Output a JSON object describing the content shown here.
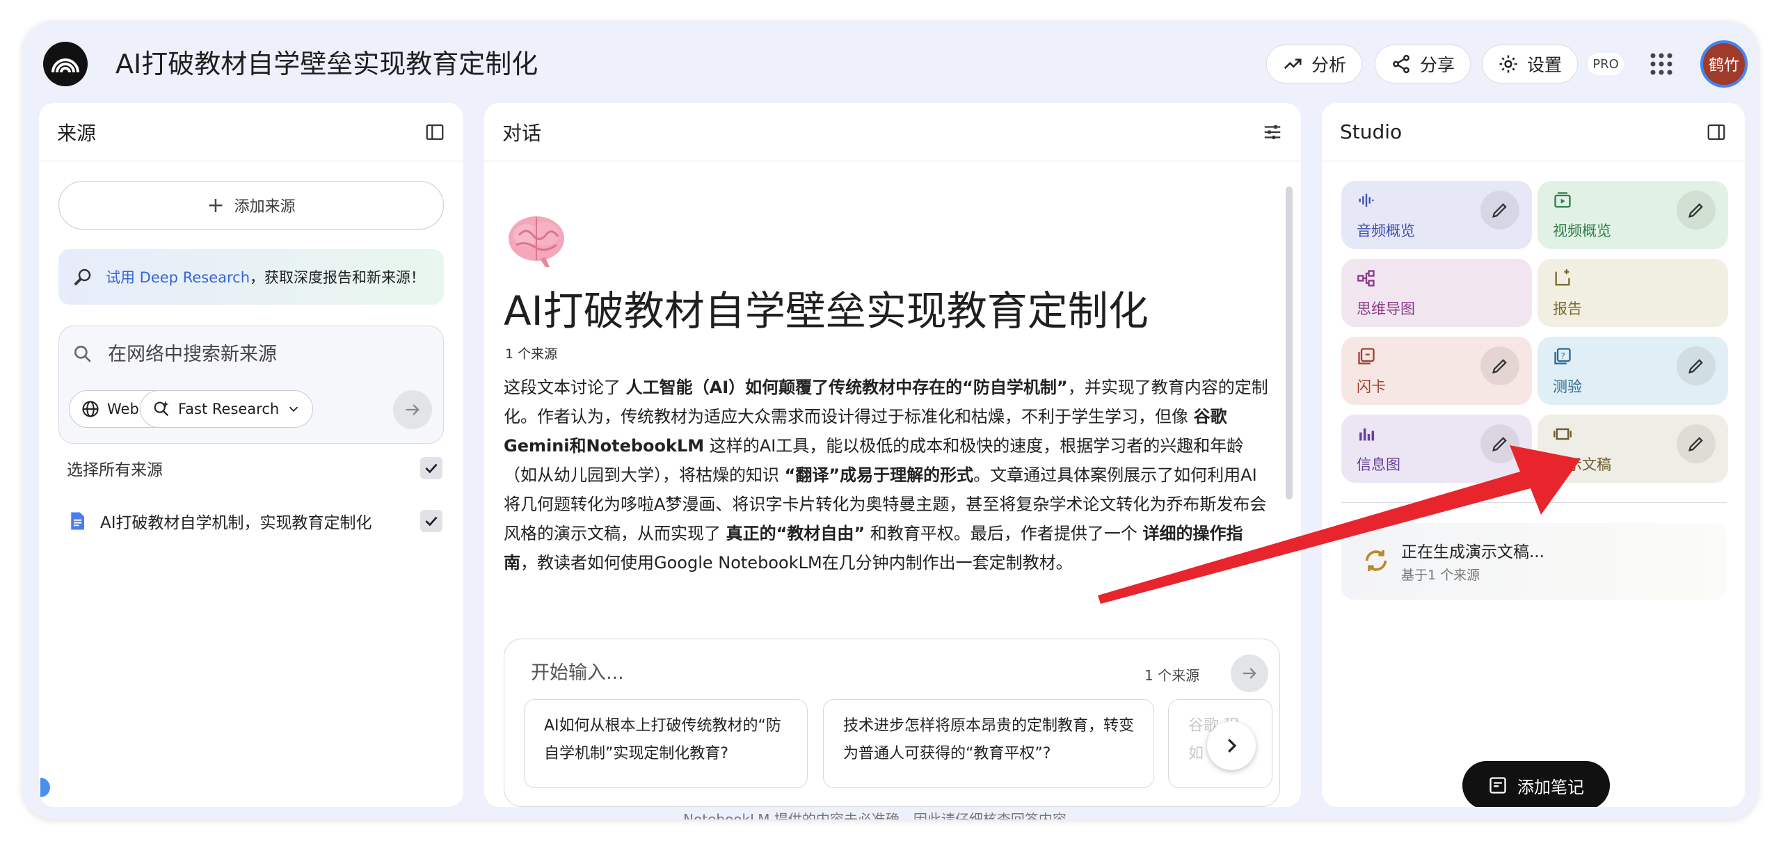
{
  "header": {
    "title": "AI打破教材自学壁垒实现教育定制化",
    "analyze_label": "分析",
    "share_label": "分享",
    "settings_label": "设置",
    "pro_badge": "PRO",
    "avatar_text": "鹤竹"
  },
  "sources": {
    "title": "来源",
    "add_label": "添加来源",
    "banner_link": "试用 Deep Research",
    "banner_text": "，获取深度报告和新来源！",
    "search_placeholder": "在网络中搜索新来源",
    "web_chip": "Web",
    "research_chip": "Fast Research",
    "select_all": "选择所有来源",
    "items": [
      {
        "label": "AI打破教材自学机制，实现教育定制化",
        "checked": true
      }
    ]
  },
  "chat": {
    "title": "对话",
    "notebook_title": "AI打破教材自学壁垒实现教育定制化",
    "source_count": "1 个来源",
    "summary": {
      "p1": "这段文本讨论了",
      "b1": "人工智能（AI）如何颠覆了传统教材中存在的“防自学机制”",
      "p2": "，并实现了教育内容的定制化。作者认为，传统教材为适应大众需求而设计得过于标准化和枯燥，不利于学生学习，但像",
      "b2": "谷歌 Gemini和NotebookLM",
      "p3": "这样的AI工具，能以极低的成本和极快的速度，根据学习者的兴趣和年龄（如从幼儿园到大学），将枯燥的知识",
      "b3": "“翻译”成易于理解的形式",
      "p4": "。文章通过具体案例展示了如何利用AI将几何题转化为哆啦A梦漫画、将识字卡片转化为奥特曼主题，甚至将复杂学术论文转化为乔布斯发布会风格的演示文稿，从而实现了",
      "b4": "真正的“教材自由”",
      "p5": "和教育平权。最后，作者提供了一个",
      "b5": "详细的操作指南",
      "p6": "，教读者如何使用Google NotebookLM在几分钟内制作出一套定制教材。"
    },
    "composer_placeholder": "开始输入...",
    "composer_count": "1 个来源",
    "suggestions": [
      "AI如何从根本上打破传统教材的“防自学机制”实现定制化教育?",
      "技术进步怎样将原本昂贵的定制教育，转变为普通人可获得的“教育平权”?",
      "谷歌 程如"
    ],
    "disclaimer": "NotebookLM 提供的内容未必准确，因此请仔细核查回答内容。"
  },
  "studio": {
    "title": "Studio",
    "tiles": [
      {
        "label": "音频概览",
        "icon": "audio-icon"
      },
      {
        "label": "视频概览",
        "icon": "video-icon"
      },
      {
        "label": "思维导图",
        "icon": "mindmap-icon"
      },
      {
        "label": "报告",
        "icon": "report-icon"
      },
      {
        "label": "闪卡",
        "icon": "flashcard-icon"
      },
      {
        "label": "测验",
        "icon": "quiz-icon"
      },
      {
        "label": "信息图",
        "icon": "infographic-icon"
      },
      {
        "label": "演示文稿",
        "icon": "slides-icon"
      }
    ],
    "generating_title": "正在生成演示文稿...",
    "generating_sub": "基于1 个来源",
    "add_note": "添加笔记"
  },
  "colors": {
    "window_bg": "#eef0fb",
    "accent_blue": "#3367d6",
    "annotation_arrow": "#e8242c"
  }
}
